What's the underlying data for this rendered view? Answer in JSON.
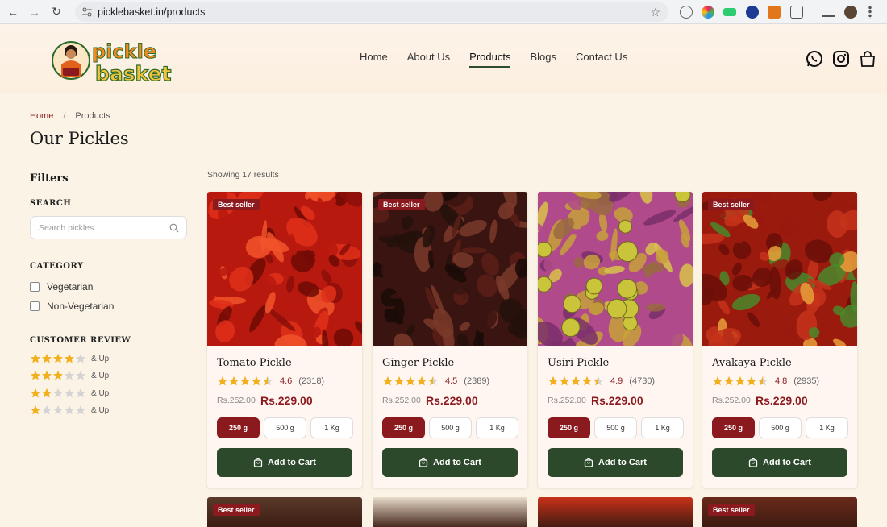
{
  "browser": {
    "url": "picklebasket.in/products"
  },
  "header": {
    "logo_text": "pickle basket",
    "nav": [
      "Home",
      "About Us",
      "Products",
      "Blogs",
      "Contact Us"
    ],
    "active_nav": "Products"
  },
  "breadcrumb": {
    "home": "Home",
    "separator": "/",
    "current": "Products"
  },
  "page_title": "Our Pickles",
  "filters": {
    "title": "Filters",
    "search_label": "SEARCH",
    "search_placeholder": "Search pickles...",
    "category_label": "CATEGORY",
    "categories": [
      "Vegetarian",
      "Non-Vegetarian"
    ],
    "review_label": "CUSTOMER REVIEW",
    "review_suffix": "& Up",
    "review_levels": [
      4,
      3,
      2,
      1
    ]
  },
  "results_text": "Showing 17 results",
  "colors": {
    "accent": "#8b1a1f",
    "cart": "#2c4a2b",
    "star": "#f2b01e"
  },
  "products": [
    {
      "name": "Tomato Pickle",
      "badge": "Best seller",
      "rating": "4.6",
      "count": "(2318)",
      "old_price": "Rs.252.00",
      "price": "Rs.229.00",
      "weights": [
        "250 g",
        "500 g",
        "1 Kg"
      ],
      "cta": "Add to Cart"
    },
    {
      "name": "Ginger Pickle",
      "badge": "Best seller",
      "rating": "4.5",
      "count": "(2389)",
      "old_price": "Rs.252.00",
      "price": "Rs.229.00",
      "weights": [
        "250 g",
        "500 g",
        "1 Kg"
      ],
      "cta": "Add to Cart"
    },
    {
      "name": "Usiri Pickle",
      "badge": "",
      "rating": "4.9",
      "count": "(4730)",
      "old_price": "Rs.252.00",
      "price": "Rs.229.00",
      "weights": [
        "250 g",
        "500 g",
        "1 Kg"
      ],
      "cta": "Add to Cart"
    },
    {
      "name": "Avakaya Pickle",
      "badge": "Best seller",
      "rating": "4.8",
      "count": "(2935)",
      "old_price": "Rs.252.00",
      "price": "Rs.229.00",
      "weights": [
        "250 g",
        "500 g",
        "1 Kg"
      ],
      "cta": "Add to Cart"
    }
  ],
  "next_row_badges": [
    "Best seller",
    "",
    "",
    "Best seller"
  ]
}
